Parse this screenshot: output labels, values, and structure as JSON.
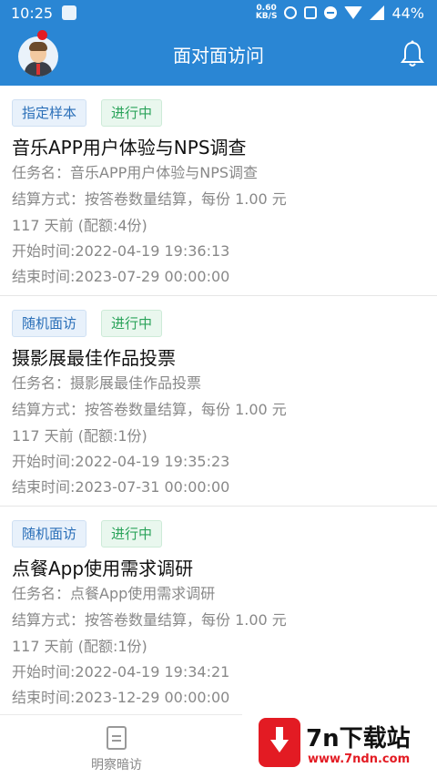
{
  "status_bar": {
    "time": "10:25",
    "speed": "0.60",
    "speed_unit": "KB/S",
    "battery": "44%"
  },
  "header": {
    "title": "面对面访问"
  },
  "tasks": [
    {
      "type_tag": "指定样本",
      "status_tag": "进行中",
      "title": "音乐APP用户体验与NPS调查",
      "task_name": "任务名：音乐APP用户体验与NPS调查",
      "settlement": "结算方式：按答卷数量结算，每份 1.00 元",
      "age": "117 天前 (配额:4份)",
      "start": "开始时间:2022-04-19 19:36:13",
      "end": "结束时间:2023-07-29 00:00:00"
    },
    {
      "type_tag": "随机面访",
      "status_tag": "进行中",
      "title": "摄影展最佳作品投票",
      "task_name": "任务名：摄影展最佳作品投票",
      "settlement": "结算方式：按答卷数量结算，每份 1.00 元",
      "age": "117 天前 (配额:1份)",
      "start": "开始时间:2022-04-19 19:35:23",
      "end": "结束时间:2023-07-31 00:00:00"
    },
    {
      "type_tag": "随机面访",
      "status_tag": "进行中",
      "title": "点餐App使用需求调研",
      "task_name": "任务名：点餐App使用需求调研",
      "settlement": "结算方式：按答卷数量结算，每份 1.00 元",
      "age": "117 天前 (配额:1份)",
      "start": "开始时间:2022-04-19 19:34:21",
      "end": "结束时间:2023-12-29 00:00:00"
    }
  ],
  "bottom_nav": {
    "item_label": "明察暗访"
  },
  "watermark": {
    "text": "7n下载站",
    "url": "www.7ndn.com"
  },
  "colors": {
    "primary": "#2a86d4",
    "tag_blue": "#2a6fb8",
    "tag_green": "#2aa35a"
  }
}
